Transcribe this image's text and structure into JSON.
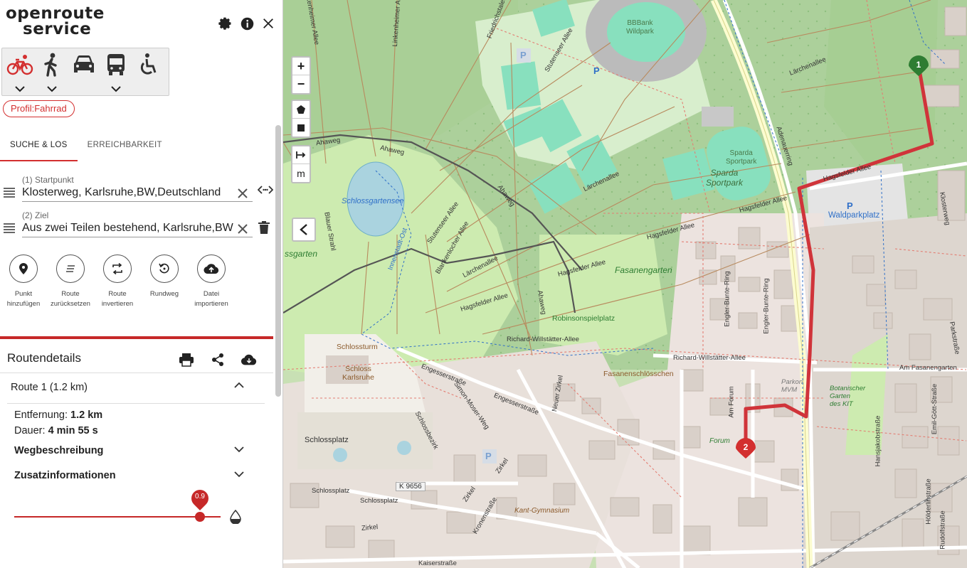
{
  "header": {
    "logo_line1": "openroute",
    "logo_line2": "service",
    "icons": [
      "gear-icon",
      "info-icon",
      "close-icon"
    ]
  },
  "profiles": {
    "items": [
      {
        "name": "bicycle",
        "icon": "bicycle-icon",
        "active": true,
        "has_menu": true
      },
      {
        "name": "walking",
        "icon": "walking-icon",
        "active": false,
        "has_menu": true
      },
      {
        "name": "car",
        "icon": "car-icon",
        "active": false,
        "has_menu": false
      },
      {
        "name": "bus",
        "icon": "bus-icon",
        "active": false,
        "has_menu": true
      },
      {
        "name": "wheelchair",
        "icon": "wheelchair-icon",
        "active": false,
        "has_menu": false
      }
    ],
    "active_color": "#d32f2f",
    "badge": "Profil:Fahrrad"
  },
  "tabs": [
    {
      "label": "SUCHE & LOS",
      "active": true
    },
    {
      "label": "ERREICHBARKEIT",
      "active": false
    }
  ],
  "waypoints": [
    {
      "label": "(1) Startpunkt",
      "value": "Klosterweg, Karlsruhe,BW,Deutschland"
    },
    {
      "label": "(2) Ziel",
      "value": "Aus zwei Teilen bestehend, Karlsruhe,BW"
    }
  ],
  "actions": [
    {
      "line1": "Punkt",
      "line2": "hinzufügen",
      "icon": "map-pin-icon"
    },
    {
      "line1": "Route",
      "line2": "zurücksetzen",
      "icon": "clear-list-icon"
    },
    {
      "line1": "Route",
      "line2": "invertieren",
      "icon": "swap-icon"
    },
    {
      "line1": "Rundweg",
      "line2": "",
      "icon": "round-trip-icon"
    },
    {
      "line1": "Datei",
      "line2": "importieren",
      "icon": "cloud-upload-icon"
    }
  ],
  "details": {
    "title": "Routendetails",
    "route_title": "Route 1 (1.2 km)",
    "distance_label": "Entfernung:",
    "distance_value": "1.2 km",
    "duration_label": "Dauer:",
    "duration_value": "4 min 55 s",
    "sections": [
      "Wegbeschreibung",
      "Zusatzinformationen"
    ],
    "opacity_value": "0.9",
    "opacity_fraction": 0.9
  },
  "map": {
    "zoom_in": "+",
    "zoom_out": "−",
    "measure_unit": "m",
    "markers": [
      {
        "label": "1",
        "color": "#2e7d32"
      },
      {
        "label": "2",
        "color": "#d32f2f"
      }
    ],
    "route_color": "#d0343a",
    "labels": {
      "stadium": [
        "BBBank",
        "Wildpark"
      ],
      "sparda": [
        "Sparda",
        "Sportpark"
      ],
      "sparda_big": [
        "Sparda",
        "Sportpark"
      ],
      "waldparkplatz": "Waldparkplatz",
      "schlossgartensee": "Schlossgartensee",
      "fasanengarten": "Fasanengarten",
      "robinsonspielplatz": "Robinsonspielplatz",
      "fasanenschloesschen": "Fasanenschlösschen",
      "schlossturm": "Schlossturm",
      "schloss_karlsruhe": [
        "Schloss",
        "Karlsruhe"
      ],
      "schlossplatz": "Schlossplatz",
      "schlossplatz_road": "Schlossplatz",
      "schlossplatz_road2": "Schlossplatz",
      "k9656": "K 9656",
      "kant_gymnasium": "Kant-Gymnasium",
      "forum": "Forum",
      "botanischer": [
        "Botanischer",
        "Garten",
        "des KIT"
      ],
      "parkon": [
        "Parkon",
        "MVM"
      ],
      "am_fasanengarten": "Am Fasanengarten",
      "richard1": "Richard-Willstätter-Allee",
      "richard2": "Richard-Willstätter-Allee",
      "hagsfelder1": "Hagsfelder Allee",
      "hagsfelder2": "Hagsfelder Allee",
      "hagsfelder3": "Hagsfelder Allee",
      "hagsfelder4": "Hagsfelder Allee",
      "hagsfelder5": "Hagsfelder Allee",
      "laerchenallee1": "Lärchenallee",
      "laerchenallee2": "Lärchenallee",
      "laerchenallee3": "Lärchenallee",
      "ahaweg1": "Ahaweg",
      "ahaweg2": "Ahaweg",
      "ahaweg3": "Ahaweg",
      "engesserstrasse1": "Engesserstraße",
      "engesserstrasse2": "Engesserstraße",
      "stutenseer1": "Stutenseer Allee",
      "stutenseer2": "Stutenseer Allee",
      "adenauerring": "Adenauerring",
      "klosterweg": "Klosterweg",
      "blankenlocher": "Blankenlocher Allee",
      "linkenheimer": "Linkenheimer Allee",
      "friedrichstaler": "Friedrichstaler",
      "engler1": "Engler-Bunte-Ring",
      "engler2": "Engler-Bunte-Ring",
      "neuer_zirkel": "Neuer Zirkel",
      "simon_moser": "Simon-Moser-Weg",
      "schlossbezirk": "Schlossbezirk",
      "zirkel1": "Zirkel",
      "zirkel2": "Zirkel",
      "zirkel3": "Zirkel",
      "kronenstrasse": "Kronenstraße",
      "kaiserstrasse": "Kaiserstraße",
      "hansjakobstrasse": "Hansjakobstraße",
      "emil_gott": "Emil-Gött-Straße",
      "hoelderlinstrasse": "Hölderlinstraße",
      "rudolfstrasse": "Rudolfstraße",
      "parkstrasse": "Parkstraße",
      "blauer_strahl": "Blauer Strahl",
      "linkenheimer_allee2": "Linkenheimer Allee",
      "ssgarten": "ssgarten",
      "mittlerer_weg": "Innenstadt-Ost",
      "ahaweg_small": "Ahaweg",
      "fasanen_neuer": "Fasanengarten",
      "am_forum": "Am Forum",
      "p": "P"
    }
  }
}
